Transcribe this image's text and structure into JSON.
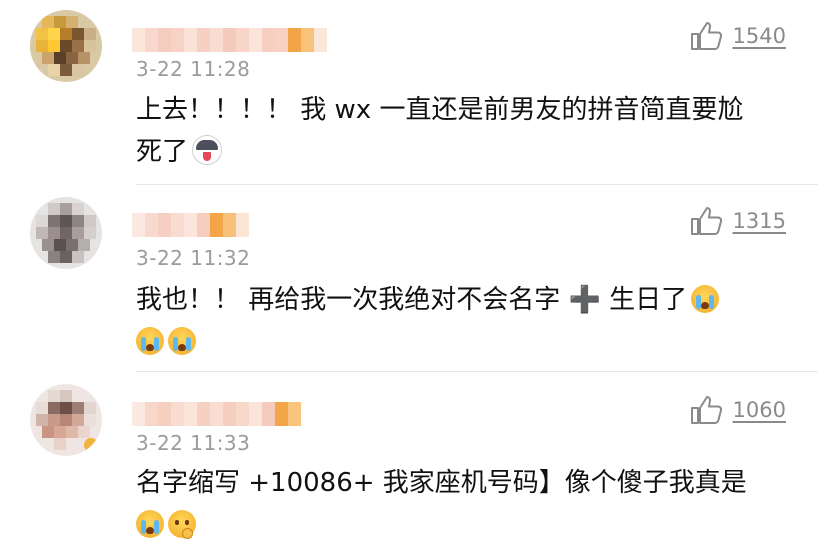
{
  "comments": [
    {
      "time": "3-22 11:28",
      "likes": "1540",
      "text_line1": "上去！！！！ 我 wx 一直还是前男友的拼音简直要尬",
      "text_line2": "死了",
      "emojis": [
        "husky-face"
      ]
    },
    {
      "time": "3-22 11:32",
      "likes": "1315",
      "text_line1": "我也！！ 再给我一次我绝对不会名字",
      "plus_symbol": "➕",
      "text_line1_after": "生日了",
      "emojis": [
        "crying-face",
        "crying-face",
        "crying-face"
      ]
    },
    {
      "time": "3-22 11:33",
      "likes": "1060",
      "text_line1": "名字缩写 +10086+ 我家座机号码】像个傻子我真是",
      "emojis": [
        "crying-face",
        "thinking-face"
      ]
    }
  ],
  "colors": {
    "time_gray": "#9b9b9b",
    "like_gray": "#8a8a8a",
    "divider": "#e6e6e6"
  }
}
